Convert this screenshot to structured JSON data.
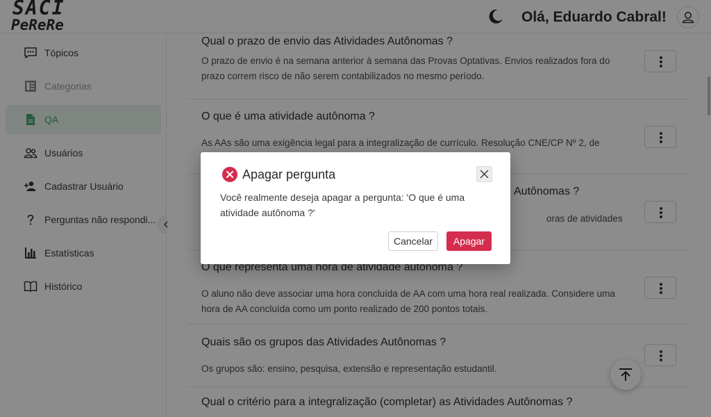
{
  "app": {
    "logo_line1": "SACI",
    "logo_line2": "PeReRe",
    "greeting": "Olá, Eduardo Cabral!"
  },
  "sidebar": {
    "items": [
      {
        "label": "Tópicos",
        "icon": "chat-icon",
        "state": "normal"
      },
      {
        "label": "Categorias",
        "icon": "document-list-icon",
        "state": "disabled"
      },
      {
        "label": "QA",
        "icon": "file-icon",
        "state": "active"
      },
      {
        "label": "Usuários",
        "icon": "users-icon",
        "state": "normal"
      },
      {
        "label": "Cadastrar Usuário",
        "icon": "add-user-icon",
        "state": "normal"
      },
      {
        "label": "Perguntas não respondi...",
        "icon": "question-icon",
        "state": "normal"
      },
      {
        "label": "Estatísticas",
        "icon": "bar-chart-icon",
        "state": "normal"
      },
      {
        "label": "Histórico",
        "icon": "book-icon",
        "state": "normal"
      }
    ]
  },
  "qa": {
    "items": [
      {
        "question": "Qual o prazo de envio das Atividades Autônomas ?",
        "answer": "O prazo de envio é na semana anterior à semana das Provas Optativas. Envios realizados fora do prazo correm risco de não serem contabilizados no mesmo período."
      },
      {
        "question": "O que é uma atividade autônoma ?",
        "answer": "As AAs são uma exigência legal para a integralização de currículo. Resolução CNE/CP Nº 2, de"
      },
      {
        "question": "Autônomas ?",
        "answer": "oras de atividades"
      },
      {
        "question": "O que representa uma hora de atividade autônoma ?",
        "answer": "O aluno não deve associar uma hora concluída de AA com uma hora real realizada. Considere uma hora de AA concluída como um ponto realizado de 200 pontos totais."
      },
      {
        "question": "Quais são os grupos das Atividades Autônomas ?",
        "answer": "Os grupos são: ensino, pesquisa, extensão e representação estudantil."
      },
      {
        "question": "Qual o critério para a integralização (completar) as Atividades Autônomas ?",
        "answer": ""
      }
    ]
  },
  "modal": {
    "title": "Apagar pergunta",
    "message": "Você realmente deseja apagar a pergunta: 'O que é uma atividade autônoma ?'",
    "cancel_label": "Cancelar",
    "delete_label": "Apagar"
  },
  "colors": {
    "accent_green": "#46a46b",
    "danger": "#d42d4d"
  }
}
